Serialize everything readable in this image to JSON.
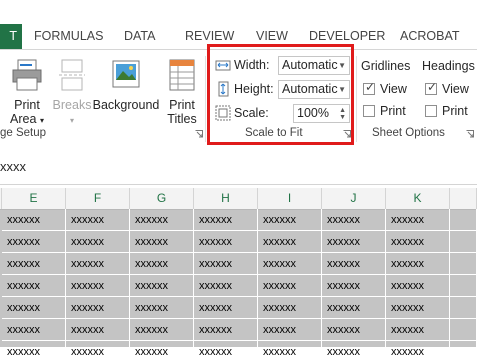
{
  "tabs": [
    {
      "label": "T",
      "active": true
    },
    {
      "label": "FORMULAS"
    },
    {
      "label": "DATA"
    },
    {
      "label": "REVIEW"
    },
    {
      "label": "VIEW"
    },
    {
      "label": "DEVELOPER"
    },
    {
      "label": "ACROBAT"
    }
  ],
  "ribbon": {
    "page_setup": {
      "group_label": "ge Setup",
      "print_area": {
        "line1": "Print",
        "line2": "Area",
        "has_dropdown": true
      },
      "breaks": {
        "label": "Breaks",
        "disabled": true,
        "has_dropdown": true
      },
      "background": {
        "label": "Background"
      },
      "print_titles": {
        "line1": "Print",
        "line2": "Titles"
      }
    },
    "scale_to_fit": {
      "group_label": "Scale to Fit",
      "width_label": "Width:",
      "width_value": "Automatic",
      "height_label": "Height:",
      "height_value": "Automatic",
      "scale_label": "Scale:",
      "scale_value": "100%"
    },
    "sheet_options": {
      "group_label": "Sheet Options",
      "gridlines": {
        "title": "Gridlines",
        "view_label": "View",
        "view_checked": true,
        "print_label": "Print",
        "print_checked": false
      },
      "headings": {
        "title": "Headings",
        "view_label": "View",
        "view_checked": true,
        "print_label": "Print",
        "print_checked": false
      }
    }
  },
  "formula_bar": {
    "content": "xxxx"
  },
  "grid": {
    "columns": [
      "E",
      "F",
      "G",
      "H",
      "I",
      "J",
      "K"
    ],
    "cell_text": "xxxxxx",
    "accent": "#217346",
    "highlight_color": "#e01b1b"
  }
}
